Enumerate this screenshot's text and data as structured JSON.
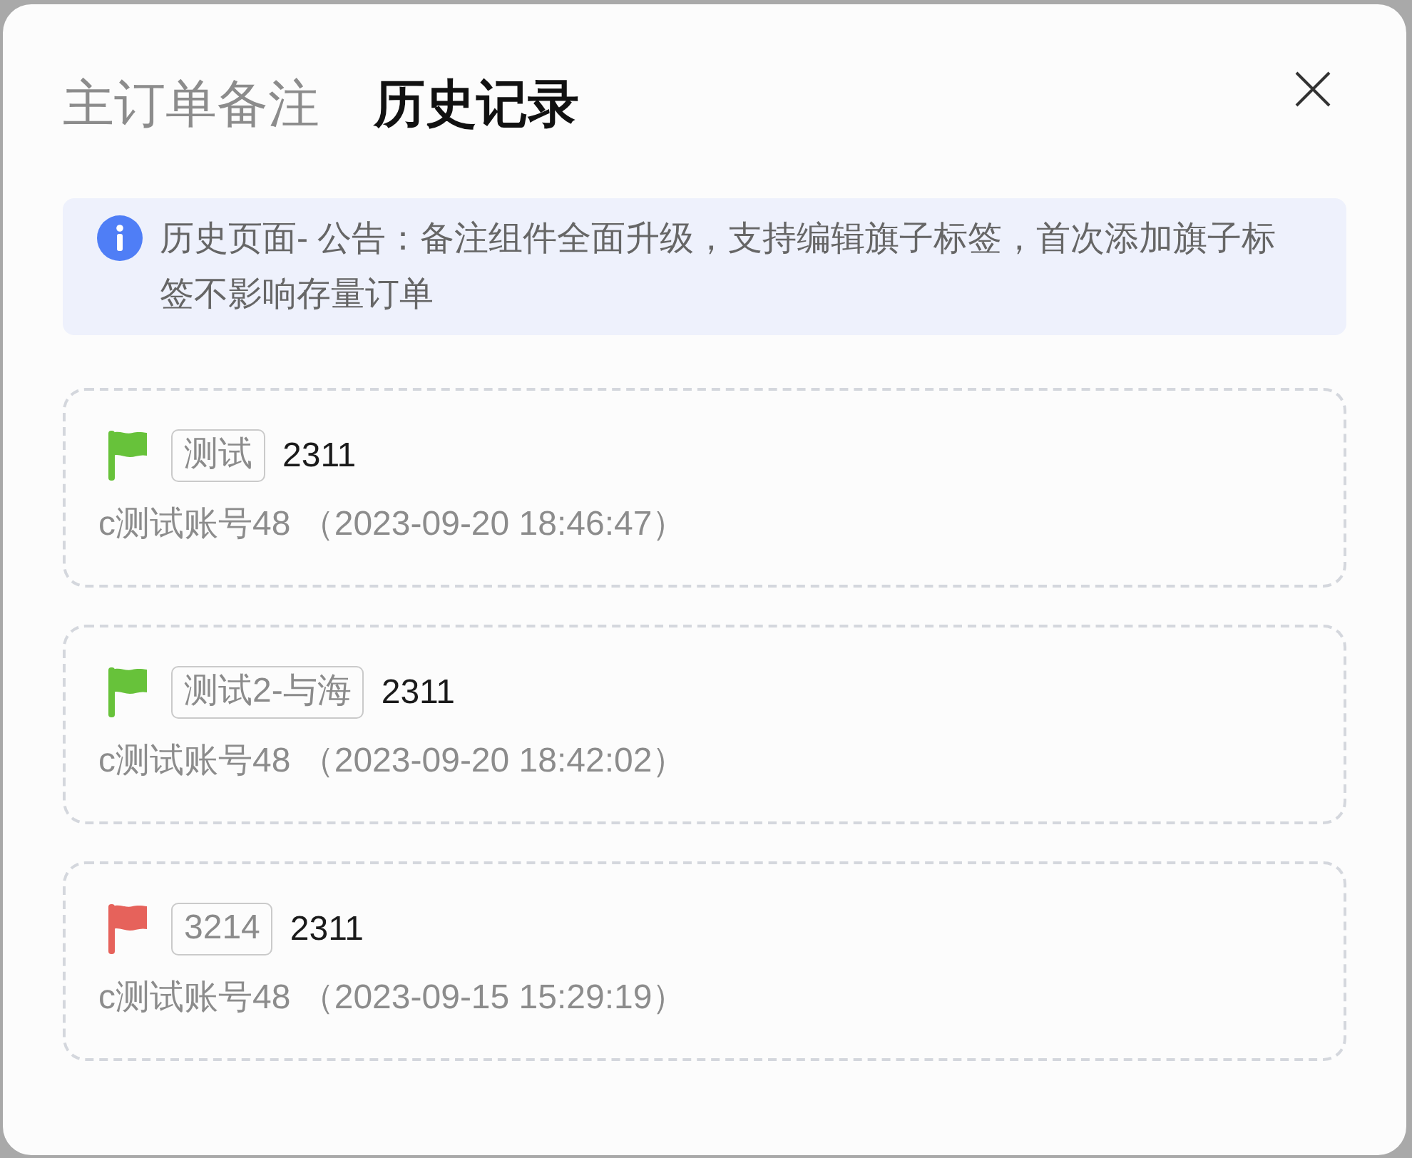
{
  "tabs": [
    {
      "label": "主订单备注",
      "selected": false
    },
    {
      "label": "历史记录",
      "selected": true
    }
  ],
  "notice": {
    "text": "历史页面- 公告：备注组件全面升级，支持编辑旗子标签，首次添加旗子标签不影响存量订单"
  },
  "records": [
    {
      "color": "#67c23a",
      "tag": "测试",
      "note": "2311",
      "byline": "c测试账号48 （2023-09-20 18:46:47）"
    },
    {
      "color": "#67c23a",
      "tag": "测试2-与海",
      "note": "2311",
      "byline": "c测试账号48 （2023-09-20 18:42:02）"
    },
    {
      "color": "#e6625b",
      "tag": "3214",
      "note": "2311",
      "byline": "c测试账号48 （2023-09-15 15:29:19）"
    }
  ]
}
